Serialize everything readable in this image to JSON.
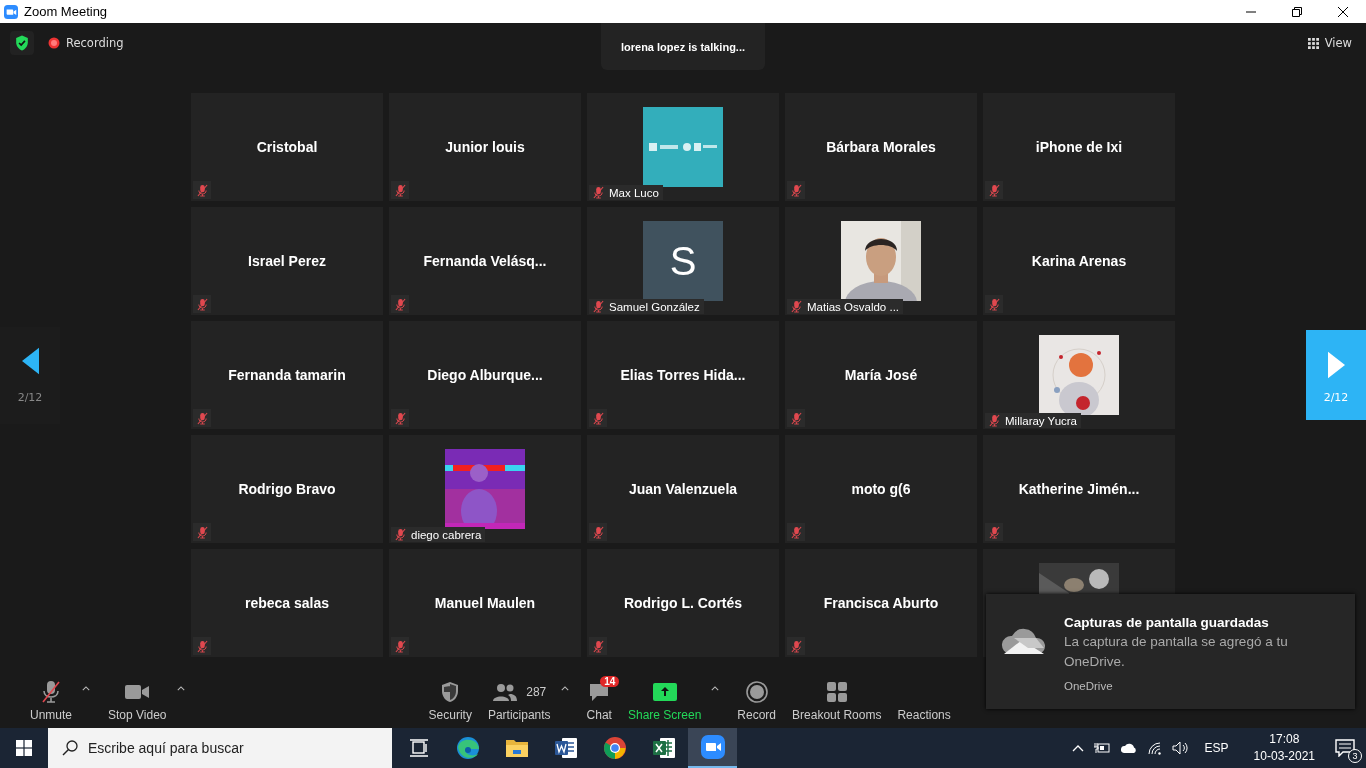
{
  "window": {
    "title": "Zoom Meeting"
  },
  "top_bar": {
    "recording": "Recording",
    "talking": "lorena lopez is talking...",
    "view": "View"
  },
  "pager": {
    "left": "2/12",
    "right": "2/12"
  },
  "tiles": [
    {
      "kind": "name",
      "name": "Cristobal",
      "muted": true
    },
    {
      "kind": "name",
      "name": "Junior louis",
      "muted": true
    },
    {
      "kind": "picture",
      "name": "Max Luco",
      "muted": true
    },
    {
      "kind": "name",
      "name": "Bárbara Morales",
      "muted": true
    },
    {
      "kind": "name",
      "name": "iPhone de Ixi",
      "muted": true
    },
    {
      "kind": "name",
      "name": "Israel Perez",
      "muted": true
    },
    {
      "kind": "name",
      "name": "Fernanda  Velásq...",
      "muted": true
    },
    {
      "kind": "initial",
      "initial": "S",
      "name": "Samuel González",
      "muted": true
    },
    {
      "kind": "picture",
      "name": "Matias Osvaldo ...",
      "muted": true
    },
    {
      "kind": "name",
      "name": "Karina Arenas",
      "muted": true
    },
    {
      "kind": "name",
      "name": "Fernanda tamarin",
      "muted": true
    },
    {
      "kind": "name",
      "name": "Diego  Alburque...",
      "muted": true
    },
    {
      "kind": "name",
      "name": "Elias  Torres  Hida...",
      "muted": true
    },
    {
      "kind": "name",
      "name": "María José",
      "muted": true
    },
    {
      "kind": "picture",
      "name": "Millaray Yucra",
      "muted": true
    },
    {
      "kind": "name",
      "name": "Rodrigo Bravo",
      "muted": true
    },
    {
      "kind": "picture",
      "name": "diego cabrera",
      "muted": true
    },
    {
      "kind": "name",
      "name": "Juan Valenzuela",
      "muted": true
    },
    {
      "kind": "name",
      "name": "moto g(6",
      "muted": true
    },
    {
      "kind": "name",
      "name": "Katherine  Jimén...",
      "muted": true
    },
    {
      "kind": "name",
      "name": "rebeca salas",
      "muted": true
    },
    {
      "kind": "name",
      "name": "Manuel Maulen",
      "muted": true
    },
    {
      "kind": "name",
      "name": "Rodrigo L. Cortés",
      "muted": true
    },
    {
      "kind": "name",
      "name": "Francisca Aburto",
      "muted": true
    },
    {
      "kind": "picture"
    }
  ],
  "toolbar_left": [
    {
      "kind": "mic",
      "label": "Unmute",
      "muted": true,
      "caret": true
    },
    {
      "kind": "video",
      "label": "Stop Video",
      "caret": true
    }
  ],
  "toolbar_center": [
    {
      "kind": "security",
      "label": "Security"
    },
    {
      "kind": "participants",
      "label": "Participants",
      "count": "287",
      "caret": true
    },
    {
      "kind": "chat",
      "label": "Chat",
      "badge": "14"
    },
    {
      "kind": "share",
      "label": "Share Screen",
      "caret": true
    },
    {
      "kind": "record",
      "label": "Record"
    },
    {
      "kind": "breakout",
      "label": "Breakout Rooms"
    },
    {
      "kind": "reactions",
      "label": "Reactions"
    }
  ],
  "notification": {
    "title": "Capturas de pantalla guardadas",
    "body": "La captura de pantalla se agregó a tu OneDrive.",
    "source": "OneDrive"
  },
  "taskbar": {
    "search": {
      "placeholder": "Escribe aquí para buscar"
    },
    "apps": [
      {
        "kind": "taskview",
        "selected": false
      },
      {
        "kind": "edge",
        "selected": false
      },
      {
        "kind": "explorer",
        "selected": false
      },
      {
        "kind": "word",
        "selected": false
      },
      {
        "kind": "chrome",
        "selected": false
      },
      {
        "kind": "excel",
        "selected": false
      },
      {
        "kind": "zoom",
        "selected": true
      }
    ],
    "language": "ESP",
    "time": "17:08",
    "date": "10-03-2021",
    "notifications": "3"
  }
}
